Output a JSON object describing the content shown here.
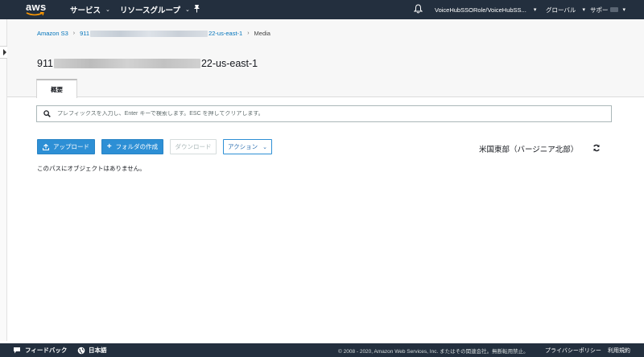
{
  "topnav": {
    "logo": "aws",
    "services_label": "サービス",
    "resource_groups_label": "リソースグループ",
    "account_label": "VoiceHubSSORole/VoiceHubSS...",
    "region_menu_label": "グローバル",
    "support_label": "サポー",
    "icons": [
      "chevron-down-icon",
      "pin-icon",
      "bell-icon"
    ]
  },
  "breadcrumb": {
    "root": "Amazon S3",
    "bucket_prefix": "911",
    "bucket_suffix": "22-us-east-1",
    "current": "Media"
  },
  "title": {
    "prefix": "911",
    "suffix": "22-us-east-1"
  },
  "tabs": [
    {
      "label": "概要"
    }
  ],
  "search": {
    "placeholder": "プレフィックスを入力し、Enter キーで検索します。ESC を押してクリアします。",
    "value": ""
  },
  "toolbar": {
    "upload_label": "アップロード",
    "create_folder_label": "フォルダの作成",
    "download_label": "ダウンロード",
    "actions_label": "アクション"
  },
  "region": "米国東部（バージニア北部）",
  "empty_message": "このパスにオブジェクトはありません。",
  "footer": {
    "feedback_label": "フィードバック",
    "language_label": "日本語",
    "copyright": "© 2008 - 2020, Amazon Web Services, Inc. またはその関連会社。無断転用禁止。",
    "privacy_label": "プライバシーポリシー",
    "terms_label": "利用規約"
  },
  "colors": {
    "nav_bg": "#232f3e",
    "link": "#0073bb",
    "primary_button": "#2d8fd5"
  }
}
